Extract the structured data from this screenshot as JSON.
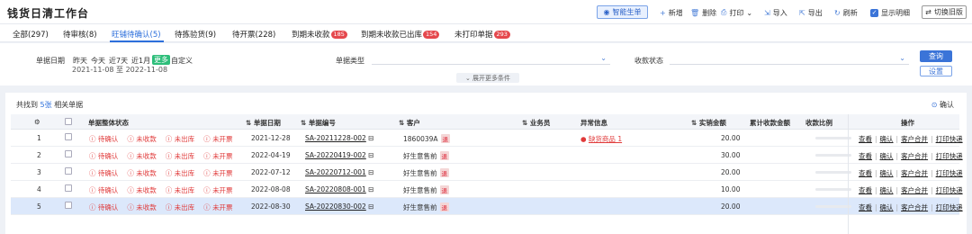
{
  "header": {
    "title": "钱货日清工作台",
    "smart_label": "智能生单",
    "toolbar": [
      "新增",
      "删除",
      "打印",
      "导入",
      "导出",
      "刷新"
    ],
    "show_detail": "显示明细",
    "old_version": "切换旧版"
  },
  "tabs": [
    {
      "label": "全部(297)"
    },
    {
      "label": "待审核(8)"
    },
    {
      "label": "旺铺待确认(5)",
      "active": true
    },
    {
      "label": "待拣验货(9)"
    },
    {
      "label": "待开票(228)"
    },
    {
      "label": "到期未收款",
      "badge": "185"
    },
    {
      "label": "到期未收款已出库",
      "badge": "154"
    },
    {
      "label": "未打印单据",
      "badge": "293"
    }
  ],
  "filter": {
    "date_label": "单据日期",
    "date_options": [
      "昨天",
      "今天",
      "近7天",
      "近1月",
      "更多",
      "自定义"
    ],
    "date_range": "2021-11-08 至 2022-11-08",
    "type_label": "单据类型",
    "receipt_label": "收款状态",
    "query": "查询",
    "settings": "设置",
    "expand": "展开更多条件"
  },
  "result": {
    "found_prefix": "共找到",
    "found_count": "5张",
    "found_suffix": "相关单据",
    "confirm": "确认"
  },
  "columns": [
    "单据整体状态",
    "单据日期",
    "单据编号",
    "客户",
    "业务员",
    "异常信息",
    "实销金额",
    "累计收款金额",
    "收款比例",
    "操作"
  ],
  "rows": [
    {
      "no": "1",
      "status": [
        "待确认",
        "未收款",
        "未出库",
        "未开票"
      ],
      "date": "2021-12-28",
      "code": "SA-20211228-002",
      "customer": "1860039A",
      "tag": "退",
      "exception": "缺货商品 1",
      "amount": "20.00"
    },
    {
      "no": "2",
      "status": [
        "待确认",
        "未收款",
        "未出库",
        "未开票"
      ],
      "date": "2022-04-19",
      "code": "SA-20220419-002",
      "customer": "好生意售前",
      "tag": "退",
      "exception": "",
      "amount": "30.00"
    },
    {
      "no": "3",
      "status": [
        "待确认",
        "未收款",
        "未出库",
        "未开票"
      ],
      "date": "2022-07-12",
      "code": "SA-20220712-001",
      "customer": "好生意售前",
      "tag": "退",
      "exception": "",
      "amount": "20.00"
    },
    {
      "no": "4",
      "status": [
        "待确认",
        "未收款",
        "未出库",
        "未开票"
      ],
      "date": "2022-08-08",
      "code": "SA-20220808-001",
      "customer": "好生意售前",
      "tag": "退",
      "exception": "",
      "amount": "10.00"
    },
    {
      "no": "5",
      "status": [
        "待确认",
        "未收款",
        "未出库",
        "未开票"
      ],
      "date": "2022-08-30",
      "code": "SA-20220830-002",
      "customer": "好生意售前",
      "tag": "退",
      "exception": "",
      "amount": "20.00"
    }
  ],
  "row_ops": [
    "查看",
    "确认",
    "客户合并",
    "打印快递"
  ]
}
